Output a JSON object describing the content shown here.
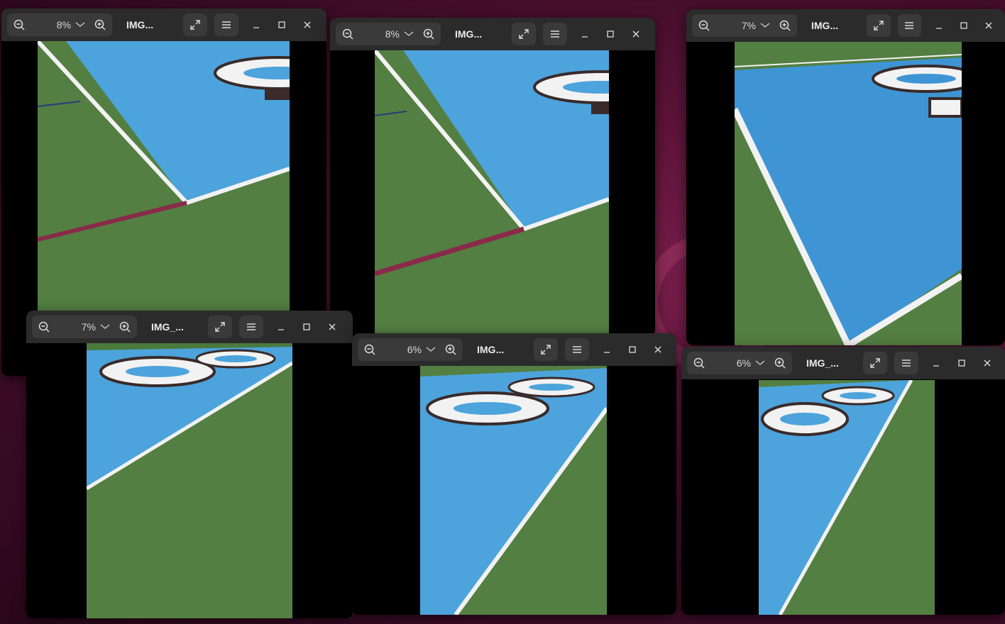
{
  "desktop": {
    "windows": [
      {
        "zoom": "8%",
        "title": "IMG..."
      },
      {
        "zoom": "8%",
        "title": "IMG..."
      },
      {
        "zoom": "7%",
        "title": "IMG..."
      },
      {
        "zoom": "7%",
        "title": "IMG_..."
      },
      {
        "zoom": "6%",
        "title": "IMG..."
      },
      {
        "zoom": "6%",
        "title": "IMG_..."
      }
    ]
  },
  "icons": {
    "zoom_out": "zoom-out-icon",
    "zoom_in": "zoom-in-icon",
    "dropdown": "chevron-down-icon",
    "fullscreen": "fullscreen-icon",
    "menu": "hamburger-menu-icon",
    "minimize": "minimize-icon",
    "maximize": "maximize-icon",
    "close": "close-icon"
  },
  "colors": {
    "turf_green": "#4f7a3f",
    "field_blue": "#4da3db",
    "line_white": "#f2f2f2",
    "line_maroon": "#8a2a4a",
    "header_bg": "#2b2b2b"
  }
}
